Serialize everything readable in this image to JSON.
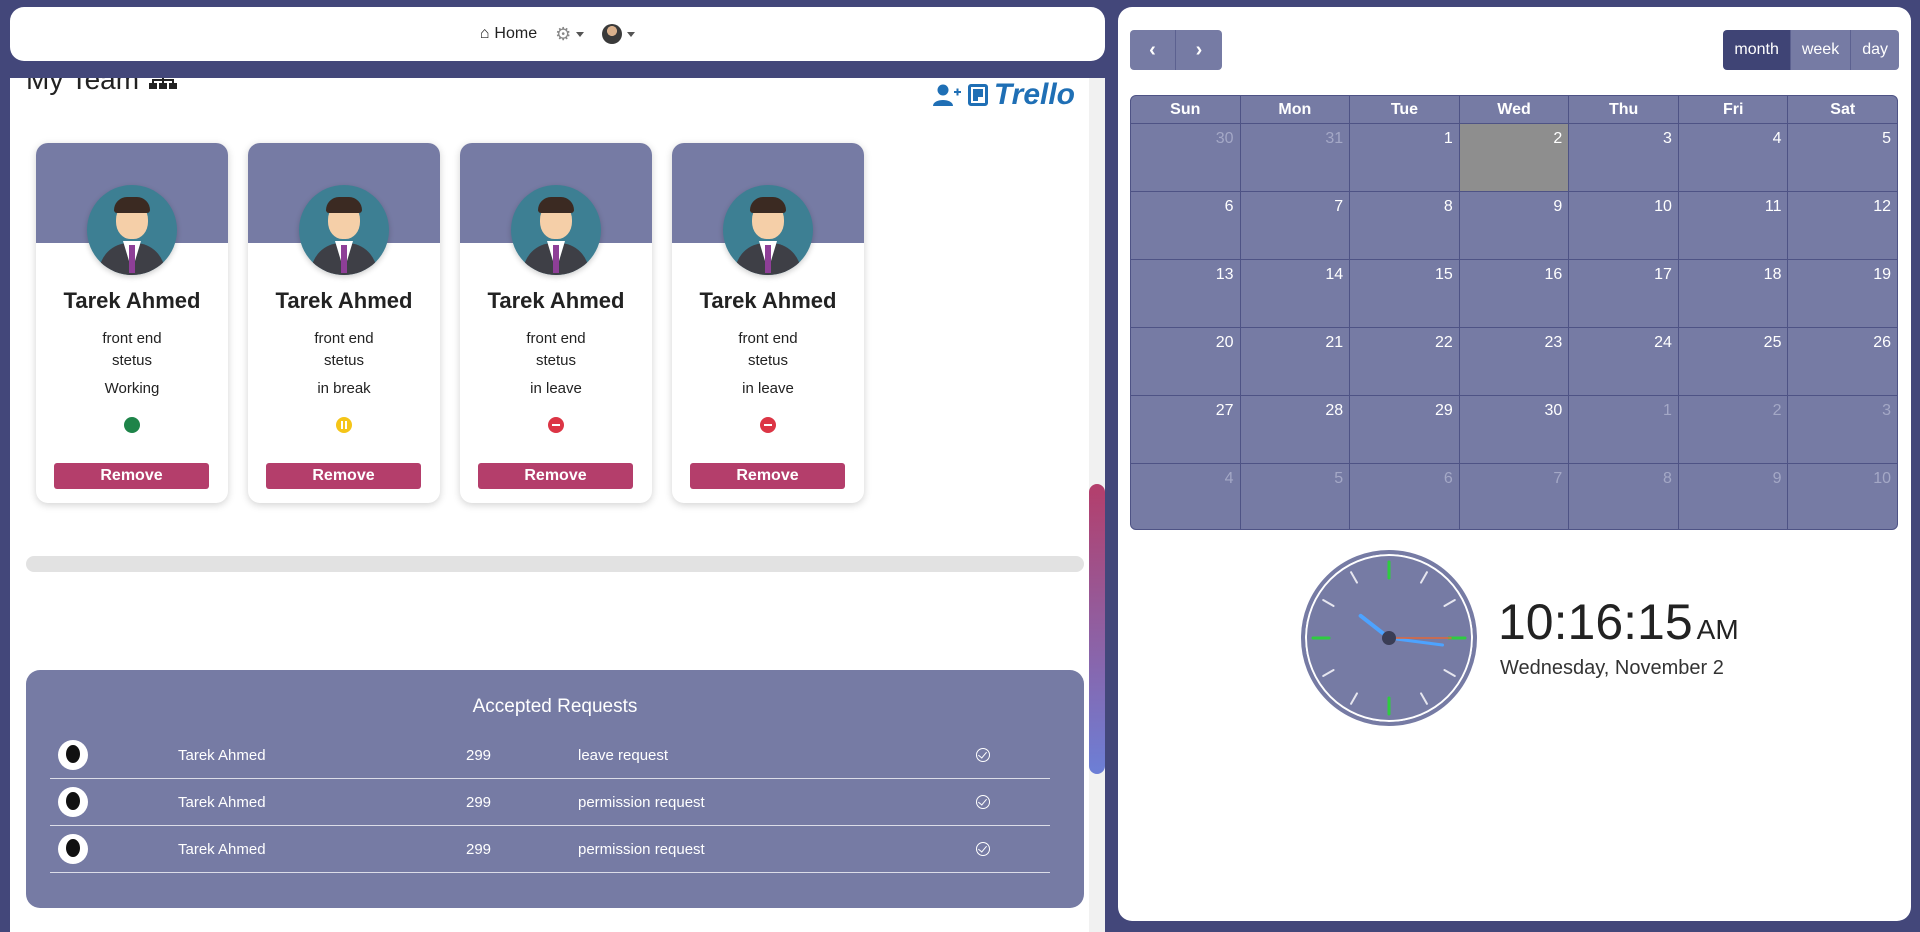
{
  "navbar": {
    "home_label": "Home"
  },
  "team": {
    "title": "My Team",
    "members": [
      {
        "name": "Tarek Ahmed",
        "role": "front end",
        "status_label": "stetus",
        "status": "Working",
        "status_color": "green",
        "remove_label": "Remove"
      },
      {
        "name": "Tarek Ahmed",
        "role": "front end",
        "status_label": "stetus",
        "status": "in break",
        "status_color": "yellow",
        "remove_label": "Remove"
      },
      {
        "name": "Tarek Ahmed",
        "role": "front end",
        "status_label": "stetus",
        "status": "in leave",
        "status_color": "red",
        "remove_label": "Remove"
      },
      {
        "name": "Tarek Ahmed",
        "role": "front end",
        "status_label": "stetus",
        "status": "in leave",
        "status_color": "red",
        "remove_label": "Remove"
      }
    ],
    "trello_label": "Trello"
  },
  "requests": {
    "title": "Accepted Requests",
    "rows": [
      {
        "name": "Tarek Ahmed",
        "number": "299",
        "type": "leave request"
      },
      {
        "name": "Tarek Ahmed",
        "number": "299",
        "type": "permission request"
      },
      {
        "name": "Tarek Ahmed",
        "number": "299",
        "type": "permission request"
      }
    ]
  },
  "calendar": {
    "views": [
      "month",
      "week",
      "day"
    ],
    "active_view": "month",
    "weekdays": [
      "Sun",
      "Mon",
      "Tue",
      "Wed",
      "Thu",
      "Fri",
      "Sat"
    ],
    "weeks": [
      [
        {
          "d": "30",
          "o": true
        },
        {
          "d": "31",
          "o": true
        },
        {
          "d": "1"
        },
        {
          "d": "2",
          "today": true
        },
        {
          "d": "3"
        },
        {
          "d": "4"
        },
        {
          "d": "5"
        }
      ],
      [
        {
          "d": "6"
        },
        {
          "d": "7"
        },
        {
          "d": "8"
        },
        {
          "d": "9"
        },
        {
          "d": "10"
        },
        {
          "d": "11"
        },
        {
          "d": "12"
        }
      ],
      [
        {
          "d": "13"
        },
        {
          "d": "14"
        },
        {
          "d": "15"
        },
        {
          "d": "16"
        },
        {
          "d": "17"
        },
        {
          "d": "18"
        },
        {
          "d": "19"
        }
      ],
      [
        {
          "d": "20"
        },
        {
          "d": "21"
        },
        {
          "d": "22"
        },
        {
          "d": "23"
        },
        {
          "d": "24"
        },
        {
          "d": "25"
        },
        {
          "d": "26"
        }
      ],
      [
        {
          "d": "27"
        },
        {
          "d": "28"
        },
        {
          "d": "29"
        },
        {
          "d": "30"
        },
        {
          "d": "1",
          "o": true
        },
        {
          "d": "2",
          "o": true
        },
        {
          "d": "3",
          "o": true
        }
      ],
      [
        {
          "d": "4",
          "o": true
        },
        {
          "d": "5",
          "o": true
        },
        {
          "d": "6",
          "o": true
        },
        {
          "d": "7",
          "o": true
        },
        {
          "d": "8",
          "o": true
        },
        {
          "d": "9",
          "o": true
        },
        {
          "d": "10",
          "o": true
        }
      ]
    ]
  },
  "clock": {
    "time": "10:16:15",
    "ampm": "AM",
    "date": "Wednesday, November 2",
    "hour": 10,
    "minute": 16,
    "second": 15
  },
  "colors": {
    "accent": "#767ba4",
    "danger": "#b43e6b",
    "background": "#43477a"
  }
}
